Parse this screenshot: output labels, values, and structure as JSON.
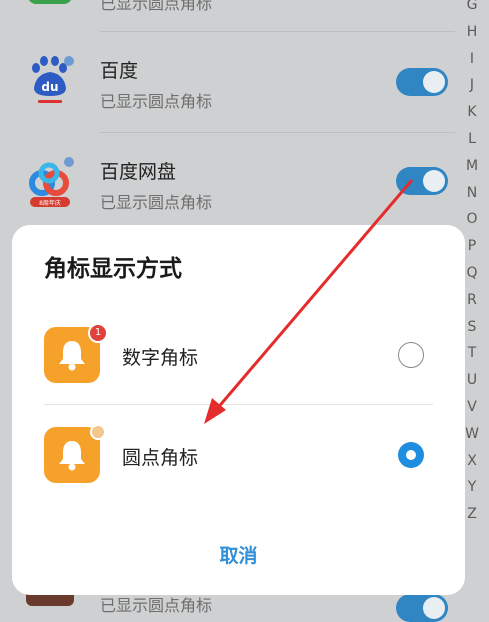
{
  "list": {
    "top_partial_sub": "已显示圆点角标",
    "items": [
      {
        "title": "百度",
        "subtitle": "已显示圆点角标",
        "toggle_on": true,
        "icon": "baidu-icon"
      },
      {
        "title": "百度网盘",
        "subtitle": "已显示圆点角标",
        "toggle_on": true,
        "icon": "baidu-netdisk-icon",
        "icon_caption": "8周年庆"
      }
    ],
    "bottom_partial_sub": "已显示圆点角标"
  },
  "index_letters": [
    "G",
    "H",
    "I",
    "J",
    "K",
    "L",
    "M",
    "N",
    "O",
    "P",
    "Q",
    "R",
    "S",
    "T",
    "U",
    "V",
    "W",
    "X",
    "Y",
    "Z"
  ],
  "dialog": {
    "title": "角标显示方式",
    "options": [
      {
        "label": "数字角标",
        "badge": "1",
        "selected": false
      },
      {
        "label": "圆点角标",
        "badge": "",
        "selected": true
      }
    ],
    "cancel": "取消"
  },
  "colors": {
    "accent": "#2f86c3",
    "bell": "#f6a12a",
    "badge_red": "#e0413b",
    "arrow": "#e52b2b"
  }
}
